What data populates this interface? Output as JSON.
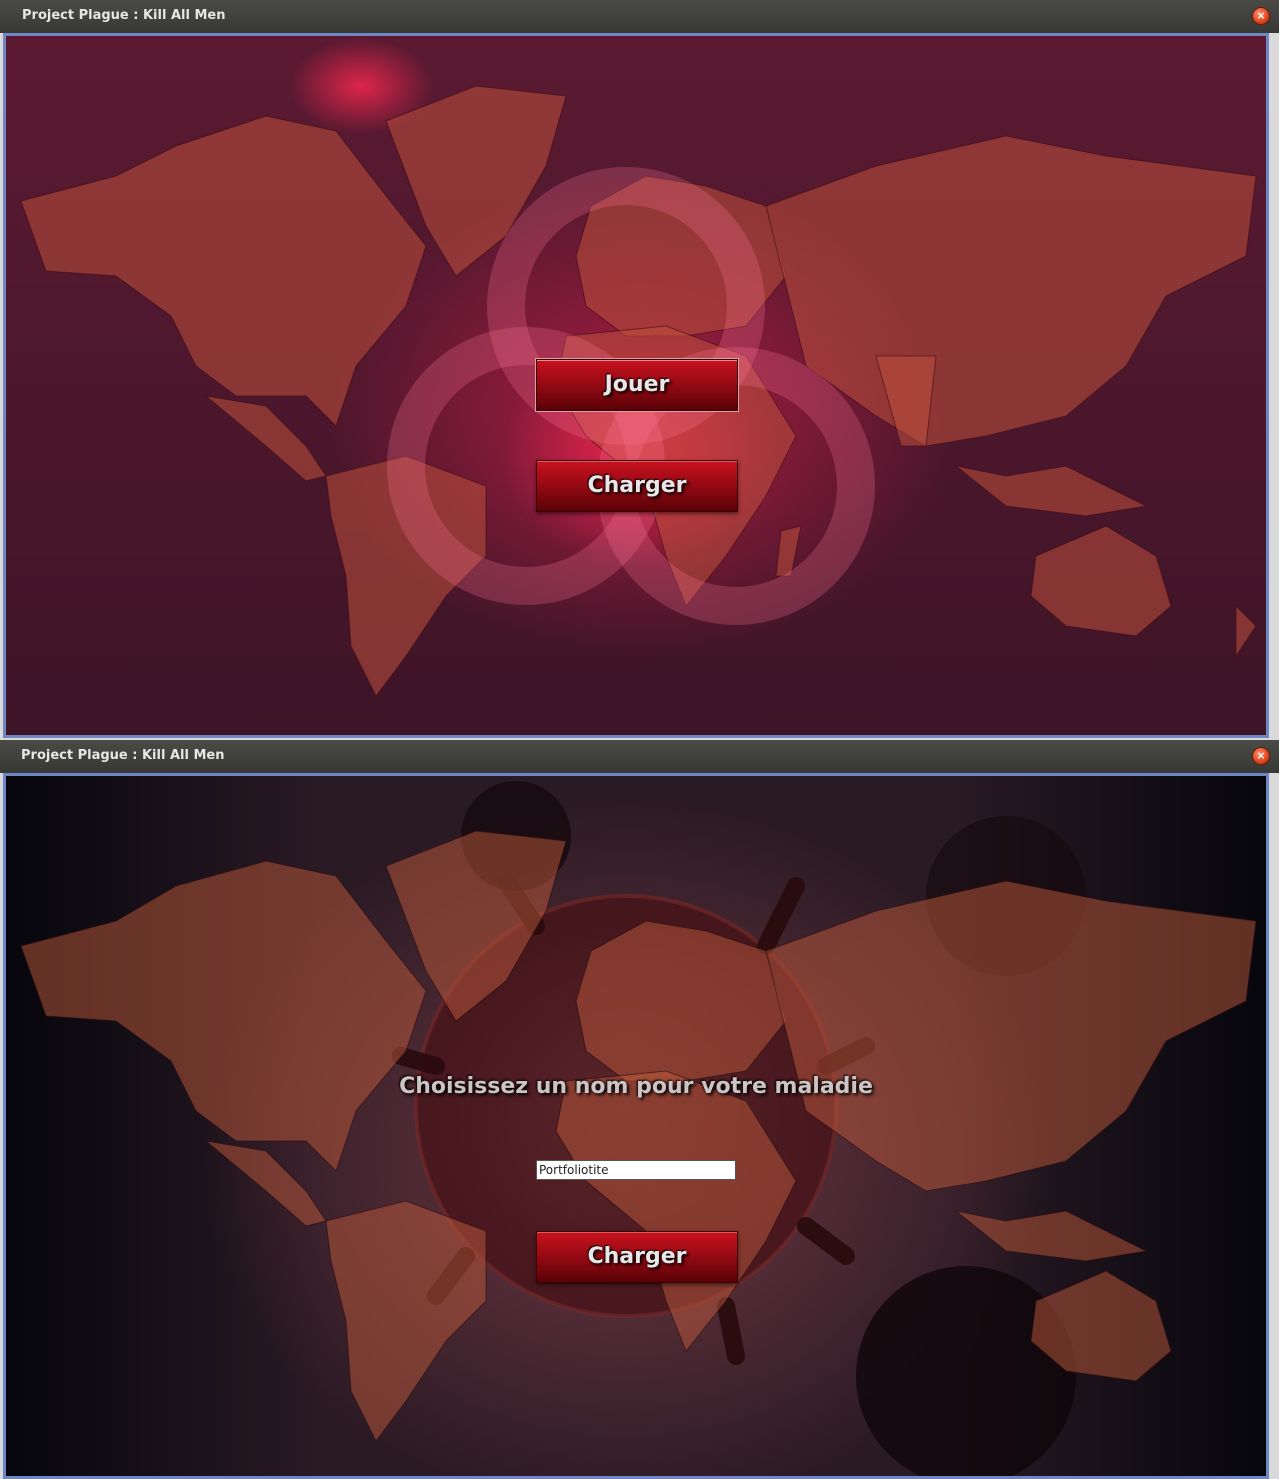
{
  "windows": [
    {
      "title": "Project Plague : Kill All Men",
      "close_icon": "close-icon",
      "buttons": {
        "play": "Jouer",
        "load": "Charger"
      }
    },
    {
      "title": "Project Plague : Kill All Men",
      "close_icon": "close-icon",
      "heading": "Choisissez un nom pour votre maladie",
      "disease_name_value": "Portfoliotite",
      "buttons": {
        "load": "Charger"
      }
    }
  ],
  "colors": {
    "button_red": "#9a0a14",
    "window_border": "#6f86c4",
    "titlebar": "#3c3c38",
    "close": "#e0441c"
  }
}
